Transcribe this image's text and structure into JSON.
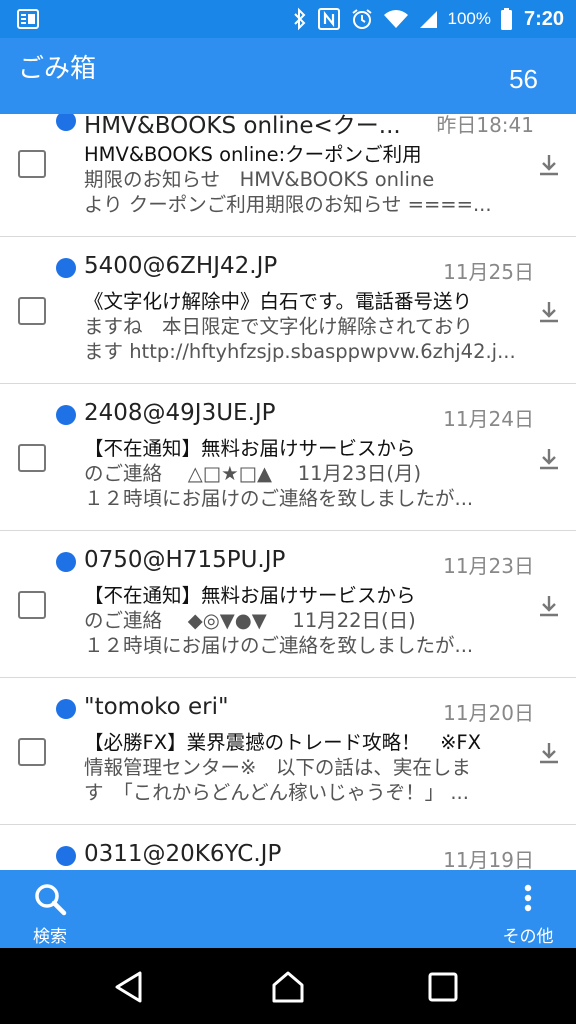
{
  "status_bar": {
    "battery": "100%",
    "time": "7:20",
    "icons": [
      "notification-icon",
      "bluetooth-icon",
      "nfc-icon",
      "alarm-icon",
      "wifi-icon",
      "signal-icon",
      "battery-icon"
    ]
  },
  "app_bar": {
    "title": "ごみ箱",
    "count": "56"
  },
  "mails": [
    {
      "sender": "HMV&BOOKS online<クー...",
      "date": "昨日18:41",
      "subject": "HMV&BOOKS online:クーポンご利用",
      "body_line1": "期限のお知らせ　HMV&BOOKS online",
      "body_line2": "より クーポンご利用期限のお知らせ ====..."
    },
    {
      "sender": "5400@6ZHJ42.JP",
      "date": "11月25日",
      "subject": "《文字化け解除中》白石です。電話番号送り",
      "body_line1": "ますね　本日限定で文字化け解除されており",
      "body_line2": "ます http://hftyhfzsjp.sbasppwpvw.6zhj42.j..."
    },
    {
      "sender": "2408@49J3UE.JP",
      "date": "11月24日",
      "subject": "【不在通知】無料お届けサービスから",
      "body_line1": "のご連絡　 △□★□▲　 11月23日(月)",
      "body_line2": "１２時頃にお届けのご連絡を致しましたが..."
    },
    {
      "sender": "0750@H715PU.JP",
      "date": "11月23日",
      "subject": "【不在通知】無料お届けサービスから",
      "body_line1": "のご連絡　 ◆◎▼●▼　 11月22日(日)",
      "body_line2": "１２時頃にお届けのご連絡を致しましたが..."
    },
    {
      "sender": "\"tomoko eri\"",
      "date": "11月20日",
      "subject": "【必勝FX】業界震撼のトレード攻略！　※FX",
      "body_line1": "情報管理センター※　以下の話は、実在しま",
      "body_line2": "す　「これからどんどん稼いじゃうぞ！」 ..."
    },
    {
      "sender": "0311@20K6YC.JP",
      "date": "11月19日",
      "subject": "",
      "body_line1": "",
      "body_line2": ""
    }
  ],
  "bottom_bar": {
    "search_label": "検索",
    "more_label": "その他"
  },
  "colors": {
    "accent": "#2f8ff0",
    "status_bar": "#1a86e8",
    "unread_dot": "#1e72e6"
  }
}
